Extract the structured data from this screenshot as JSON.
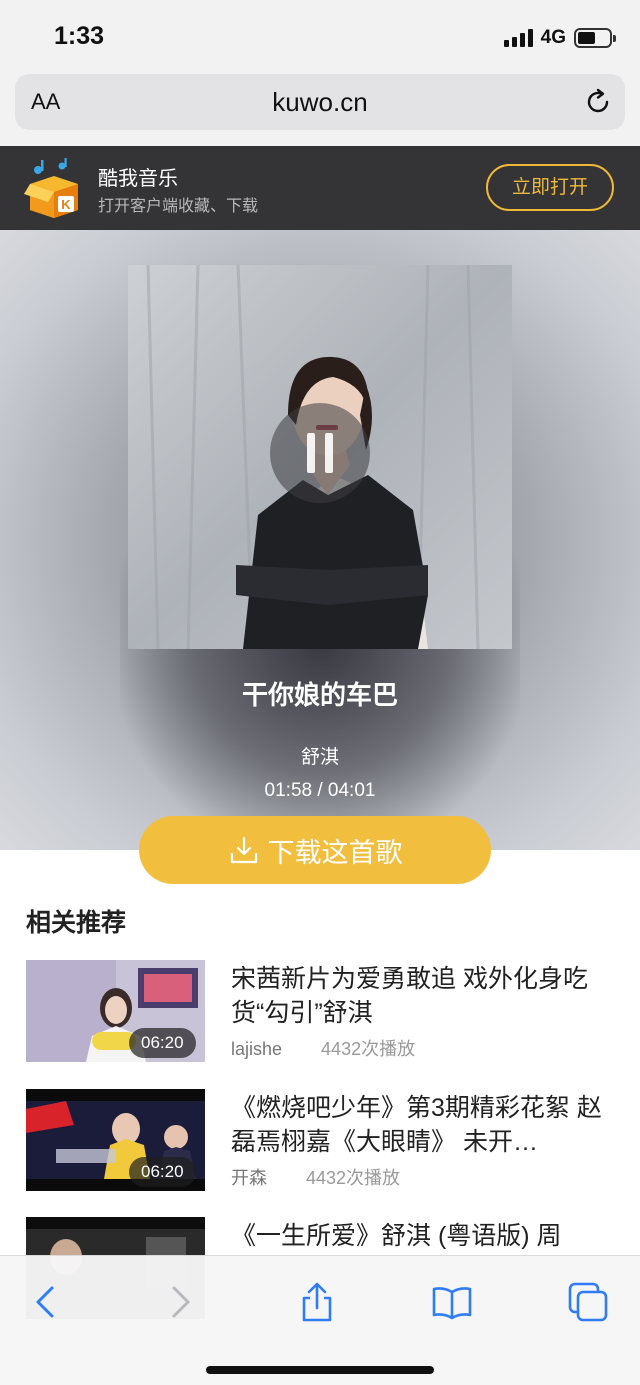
{
  "status_bar": {
    "time": "1:33",
    "network": "4G",
    "battery_level": 0.55
  },
  "browser": {
    "aa_label": "AA",
    "url": "kuwo.cn"
  },
  "app_banner": {
    "name": "酷我音乐",
    "subtitle": "打开客户端收藏、下载",
    "open_label": "立即打开"
  },
  "player": {
    "song_title": "干你娘的车巴",
    "artist": "舒淇",
    "time": "01:58 / 04:01",
    "download_label": "下载这首歌"
  },
  "recommendations": {
    "title": "相关推荐",
    "items": [
      {
        "title": "宋茜新片为爱勇敢追 戏外化身吃货“勾引”舒淇",
        "uploader": "lajishe",
        "plays": "4432次播放",
        "duration": "06:20"
      },
      {
        "title": "《燃烧吧少年》第3期精彩花絮 赵磊焉栩嘉《大眼睛》 未开…",
        "uploader": "开森",
        "plays": "4432次播放",
        "duration": "06:20"
      },
      {
        "title": "《一生所爱》舒淇 (粤语版) 周",
        "uploader": "",
        "plays": "",
        "duration": ""
      }
    ]
  },
  "colors": {
    "accent": "#f2be3e",
    "banner_bg": "#343437",
    "link_blue": "#2f7cf6"
  }
}
